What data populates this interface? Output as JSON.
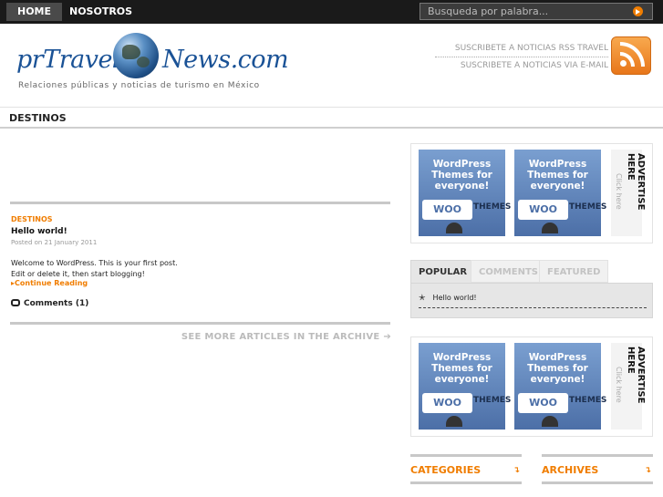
{
  "nav": {
    "items": [
      "HOME",
      "NOSOTROS"
    ],
    "search_placeholder": "Busqueda por palabra..."
  },
  "header": {
    "logo_part1": "prTravel",
    "logo_part2": "News.com",
    "tagline": "Relaciones públicas y noticias de turismo en México",
    "subscribe_rss": "SUSCRIBETE A NOTICIAS RSS TRAVEL",
    "subscribe_email": "SUSCRIBETE A NOTICIAS VIA E-MAIL"
  },
  "section_title": "DESTINOS",
  "post": {
    "category": "DESTINOS",
    "title": "Hello world!",
    "meta": "Posted on 21 January 2011",
    "excerpt": "Welcome to WordPress. This is your first post. Edit or delete it, then start blogging!",
    "continue_label": "Continue Reading",
    "comments_label": "Comments (1)"
  },
  "archive_link": "SEE MORE ARTICLES IN THE ARCHIVE",
  "ads": {
    "ad_text": "WordPress Themes for everyone!",
    "woo": "WOO",
    "themes": "THEMES",
    "advertise": "ADVERTISE HERE",
    "click": "Click here"
  },
  "tabs": {
    "labels": [
      "POPULAR",
      "COMMENTS",
      "FEATURED"
    ],
    "popular_items": [
      "Hello world!"
    ]
  },
  "widgets": {
    "categories": "CATEGORIES",
    "archives": "ARCHIVES"
  },
  "colors": {
    "accent": "#f07d00",
    "logo_blue": "#1a5296",
    "topbar": "#1a1a1a"
  }
}
